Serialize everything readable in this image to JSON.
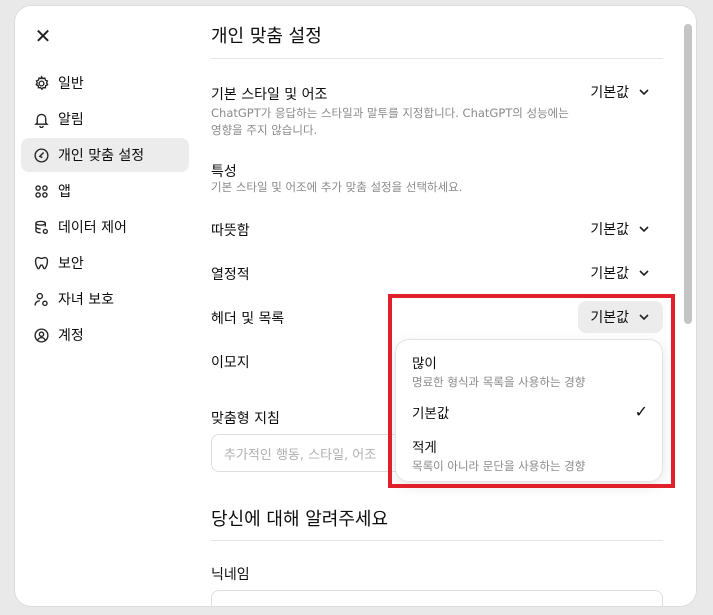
{
  "sidebar": {
    "items": [
      {
        "label": "일반",
        "icon": "gear-icon"
      },
      {
        "label": "알림",
        "icon": "bell-icon"
      },
      {
        "label": "개인 맞춤 설정",
        "icon": "personalization-icon",
        "active": true
      },
      {
        "label": "앱",
        "icon": "apps-grid-icon"
      },
      {
        "label": "데이터 제어",
        "icon": "database-icon"
      },
      {
        "label": "보안",
        "icon": "shield-icon"
      },
      {
        "label": "자녀 보호",
        "icon": "parental-icon"
      },
      {
        "label": "계정",
        "icon": "account-icon"
      }
    ]
  },
  "main": {
    "title": "개인 맞춤 설정",
    "style_tone": {
      "label": "기본 스타일 및 어조",
      "desc": "ChatGPT가 응답하는 스타일과 말투를 지정합니다. ChatGPT의 성능에는 영향을 주지 않습니다.",
      "value": "기본값"
    },
    "traits": {
      "label": "특성",
      "desc": "기본 스타일 및 어조에 추가 맞춤 설정을 선택하세요."
    },
    "warmth": {
      "label": "따뜻함",
      "value": "기본값"
    },
    "enthusiasm": {
      "label": "열정적",
      "value": "기본값"
    },
    "headers_lists": {
      "label": "헤더 및 목록",
      "value": "기본값"
    },
    "emoji": {
      "label": "이모지"
    },
    "custom_instructions": {
      "label": "맞춤형 지침",
      "placeholder": "추가적인 행동, 스타일, 어조"
    },
    "about_you": {
      "title": "당신에 대해 알려주세요"
    },
    "nickname": {
      "label": "닉네임"
    }
  },
  "dropdown": {
    "options": [
      {
        "label": "많이",
        "desc": "명료한 형식과 목록을 사용하는 경향"
      },
      {
        "label": "기본값",
        "desc": "",
        "selected": true
      },
      {
        "label": "적게",
        "desc": "목록이 아니라 문단을 사용하는 경향"
      }
    ]
  },
  "colors": {
    "highlight": "#e0202a",
    "active_bg": "#ececec"
  }
}
